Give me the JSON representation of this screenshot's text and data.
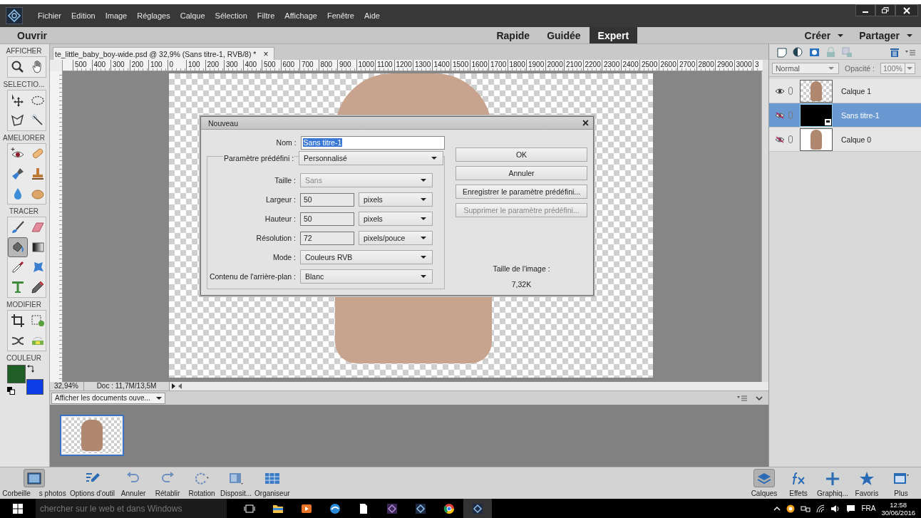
{
  "menu": [
    "Fichier",
    "Edition",
    "Image",
    "Réglages",
    "Calque",
    "Sélection",
    "Filtre",
    "Affichage",
    "Fenêtre",
    "Aide"
  ],
  "mode_bar": {
    "open": "Ouvrir",
    "modes": [
      {
        "label": "Rapide",
        "selected": false
      },
      {
        "label": "Guidée",
        "selected": false
      },
      {
        "label": "Expert",
        "selected": true
      }
    ],
    "actions": [
      "Créer",
      "Partager"
    ]
  },
  "toolbox": {
    "sections": [
      {
        "label": "AFFICHER",
        "tools": [
          {
            "selected": false
          },
          {
            "selected": false
          }
        ]
      },
      {
        "label": "SELECTIO...",
        "tools": [
          {
            "selected": false
          },
          {
            "selected": false
          },
          {
            "selected": false
          },
          {
            "selected": false
          }
        ]
      },
      {
        "label": "AMELIORER",
        "tools": [
          {
            "selected": false
          },
          {
            "selected": false
          },
          {
            "selected": false
          },
          {
            "selected": false
          },
          {
            "selected": false
          },
          {
            "selected": false
          }
        ]
      },
      {
        "label": "TRACER",
        "tools": [
          {
            "selected": false
          },
          {
            "selected": false
          },
          {
            "selected": true
          },
          {
            "selected": false
          },
          {
            "selected": false
          },
          {
            "selected": false
          },
          {
            "selected": false
          },
          {
            "selected": false
          }
        ]
      },
      {
        "label": "MODIFIER",
        "tools": [
          {
            "selected": false
          },
          {
            "selected": false
          },
          {
            "selected": false
          },
          {
            "selected": false
          }
        ]
      }
    ],
    "color_label": "COULEUR",
    "swatches": [
      {
        "color": "#1f5e25"
      },
      {
        "color": "#0b3ee6"
      }
    ]
  },
  "document": {
    "tab_title": "te_little_baby_boy-wide.psd @ 32,9% (Sans titre-1, RVB/8) *",
    "tab_close": "×",
    "ruler_labels": [
      "500",
      "400",
      "300",
      "200",
      "100",
      "0",
      "100",
      "200",
      "300",
      "400",
      "500",
      "600",
      "700",
      "800",
      "900",
      "1000",
      "1100",
      "1200",
      "1300",
      "1400",
      "1500",
      "1600",
      "1700",
      "1800",
      "1900",
      "2000",
      "2100",
      "2200",
      "2300",
      "2400",
      "2500",
      "2600",
      "2700",
      "2800",
      "2900",
      "3000",
      "3"
    ],
    "zoom": "32,94%",
    "doc_size": "Doc : 11,7M/13,5M"
  },
  "dialog": {
    "title": "Nouveau",
    "close": "×",
    "name_field": {
      "label": "Nom :",
      "value": "Sans titre-1",
      "value_selected": true
    },
    "preset": {
      "label": "Paramètre prédéfini :",
      "value": "Personnalisé"
    },
    "rows": [
      {
        "kind": "select",
        "label": "Taille :",
        "value": "Sans",
        "disabled": true
      },
      {
        "kind": "number_unit",
        "label": "Largeur :",
        "value": "50",
        "unit": "pixels"
      },
      {
        "kind": "number_unit",
        "label": "Hauteur :",
        "value": "50",
        "unit": "pixels"
      },
      {
        "kind": "number_unit",
        "label": "Résolution :",
        "value": "72",
        "unit": "pixels/pouce"
      },
      {
        "kind": "select",
        "label": "Mode :",
        "value": "Couleurs RVB",
        "disabled": false
      },
      {
        "kind": "select",
        "label": "Contenu de l'arrière-plan :",
        "value": "Blanc",
        "disabled": false
      }
    ],
    "buttons": [
      {
        "label": "OK",
        "disabled": false
      },
      {
        "label": "Annuler",
        "disabled": false
      },
      {
        "label": "Enregistrer le paramètre prédéfini...",
        "disabled": false
      },
      {
        "label": "Supprimer le paramètre prédéfini...",
        "disabled": true
      }
    ],
    "size_label": "Taille de l'image :",
    "size_value": "7,32K"
  },
  "photo_bin": {
    "dropdown": "Afficher les documents ouve...",
    "thumbnails": [
      {
        "selected": true
      }
    ]
  },
  "layers_panel": {
    "blend_mode": "Normal",
    "opacity_label": "Opacité :",
    "opacity": "100%",
    "layers": [
      {
        "name": "Calque 1",
        "kind": "photo",
        "visible": true,
        "selected": false
      },
      {
        "name": "Sans titre-1",
        "kind": "solid",
        "visible": false,
        "selected": true
      },
      {
        "name": "Calque 0",
        "kind": "photo_white",
        "visible": false,
        "selected": false
      }
    ]
  },
  "bottom_toolbar": {
    "left": [
      {
        "label_parts": [
          "Corbeille",
          "s photos"
        ],
        "selected": true
      },
      {
        "label_parts": [
          "Options d'outil"
        ],
        "selected": false
      },
      {
        "label_parts": [
          "Annuler"
        ],
        "selected": false
      },
      {
        "label_parts": [
          "Rétablir"
        ],
        "selected": false
      },
      {
        "label_parts": [
          "Rotation"
        ],
        "selected": false
      },
      {
        "label_parts": [
          "Disposit..."
        ],
        "selected": false
      },
      {
        "label_parts": [
          "Organiseur"
        ],
        "selected": false
      }
    ],
    "right": [
      {
        "label_parts": [
          "Calques"
        ],
        "selected": true
      },
      {
        "label_parts": [
          "Effets"
        ],
        "selected": false
      },
      {
        "label_parts": [
          "Graphiq..."
        ],
        "selected": false
      },
      {
        "label_parts": [
          "Favoris"
        ],
        "selected": false
      },
      {
        "label_parts": [
          "Plus"
        ],
        "selected": false
      }
    ]
  },
  "taskbar": {
    "search_placeholder": "chercher sur le web et dans Windows",
    "language": "FRA",
    "time": "12:58",
    "date": "30/06/2016"
  }
}
